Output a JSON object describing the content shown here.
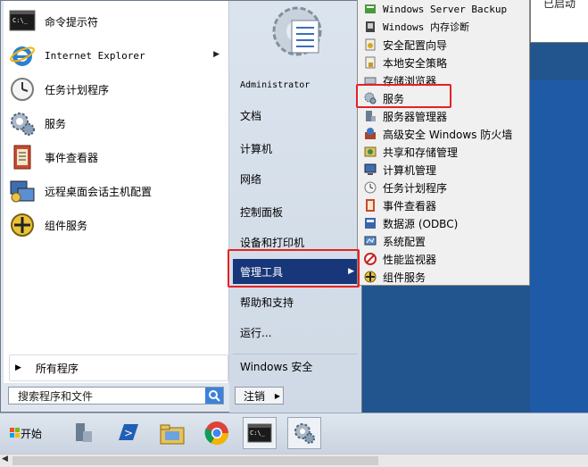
{
  "background_window_text": "已启动",
  "left_programs": [
    {
      "label": "命令提示符",
      "icon": "cmd-icon"
    },
    {
      "label": "Internet Explorer",
      "icon": "ie-icon",
      "has_arrow": true
    },
    {
      "label": "任务计划程序",
      "icon": "clock-icon"
    },
    {
      "label": "服务",
      "icon": "services-gear-icon"
    },
    {
      "label": "事件查看器",
      "icon": "event-viewer-icon"
    },
    {
      "label": "远程桌面会话主机配置",
      "icon": "remote-desktop-icon"
    },
    {
      "label": "组件服务",
      "icon": "component-services-icon"
    }
  ],
  "all_programs_label": "所有程序",
  "search_placeholder": "搜索程序和文件",
  "right_items": [
    {
      "label": "Administrator"
    },
    {
      "label": "文档"
    },
    {
      "label": "计算机"
    },
    {
      "label": "网络"
    },
    {
      "label": "控制面板"
    },
    {
      "label": "设备和打印机"
    },
    {
      "label": "管理工具",
      "selected": true,
      "has_arrow": true
    },
    {
      "label": "帮助和支持"
    },
    {
      "label": "运行..."
    },
    {
      "label": "Windows 安全"
    }
  ],
  "logout_label": "注销",
  "admin_tools_submenu": [
    {
      "label": "Windows Server Backup",
      "icon": "backup-icon"
    },
    {
      "label": "Windows 内存诊断",
      "icon": "memory-diagnostic-icon"
    },
    {
      "label": "安全配置向导",
      "icon": "security-wizard-icon"
    },
    {
      "label": "本地安全策略",
      "icon": "local-security-icon"
    },
    {
      "label": "存储浏览器",
      "icon": "storage-explorer-icon"
    },
    {
      "label": "服务",
      "icon": "services-icon"
    },
    {
      "label": "服务器管理器",
      "icon": "server-manager-icon"
    },
    {
      "label": "高级安全 Windows 防火墙",
      "icon": "firewall-icon"
    },
    {
      "label": "共享和存储管理",
      "icon": "share-storage-icon"
    },
    {
      "label": "计算机管理",
      "icon": "computer-management-icon"
    },
    {
      "label": "任务计划程序",
      "icon": "task-scheduler-icon"
    },
    {
      "label": "事件查看器",
      "icon": "event-viewer-icon"
    },
    {
      "label": "数据源 (ODBC)",
      "icon": "odbc-icon"
    },
    {
      "label": "系统配置",
      "icon": "system-config-icon"
    },
    {
      "label": "性能监视器",
      "icon": "performance-monitor-icon"
    },
    {
      "label": "组件服务",
      "icon": "component-services-icon"
    }
  ],
  "taskbar": {
    "start_label": "开始",
    "items": [
      "server-manager-icon",
      "powershell-icon",
      "file-explorer-icon",
      "chrome-icon",
      "cmd-icon",
      "services-icon"
    ]
  },
  "colors": {
    "selected_bg": "#18377a",
    "highlight": "#e52222",
    "desktop": "#22548e"
  }
}
